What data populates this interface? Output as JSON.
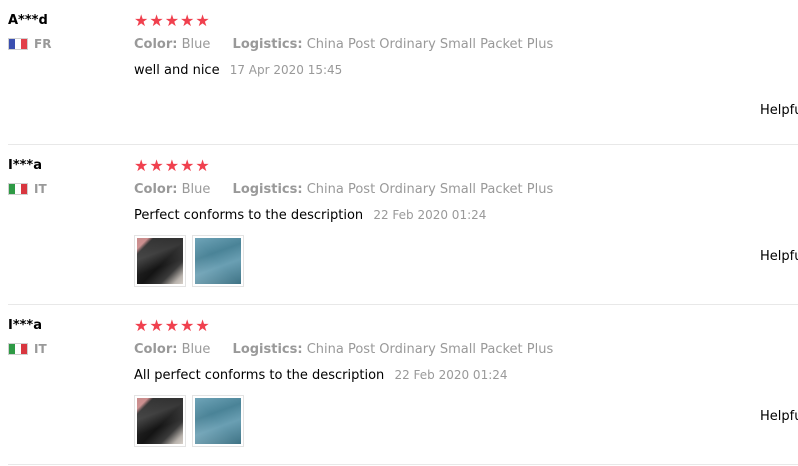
{
  "colors": {
    "star": "#f0404e",
    "muted": "#999999",
    "text": "#000000"
  },
  "labels": {
    "color": "Color:",
    "logistics": "Logistics:",
    "helpful": "Helpful"
  },
  "reviews": [
    {
      "user": "A***d",
      "country": "FR",
      "flag_icon": "france-flag-icon",
      "stars": "★★★★★",
      "color_value": "Blue",
      "logistics_value": "China Post Ordinary Small Packet Plus",
      "text": "well and nice",
      "date": "17 Apr 2020 15:45",
      "photos": []
    },
    {
      "user": "I***a",
      "country": "IT",
      "flag_icon": "italy-flag-icon",
      "stars": "★★★★★",
      "color_value": "Blue",
      "logistics_value": "China Post Ordinary Small Packet Plus",
      "text": "Perfect conforms to the description",
      "date": "22 Feb 2020 01:24",
      "photos": [
        "black-item-photo",
        "blue-item-photo"
      ]
    },
    {
      "user": "I***a",
      "country": "IT",
      "flag_icon": "italy-flag-icon",
      "stars": "★★★★★",
      "color_value": "Blue",
      "logistics_value": "China Post Ordinary Small Packet Plus",
      "text": "All perfect conforms to the description",
      "date": "22 Feb 2020 01:24",
      "photos": [
        "black-item-photo",
        "blue-item-photo"
      ]
    }
  ]
}
